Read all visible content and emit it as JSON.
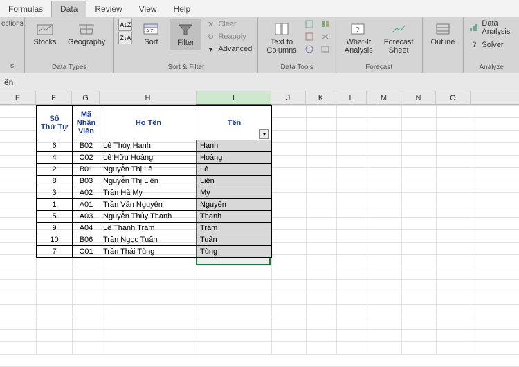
{
  "tabs": {
    "formulas": "Formulas",
    "data": "Data",
    "review": "Review",
    "view": "View",
    "help": "Help"
  },
  "sideLeft": {
    "top": "ections",
    "bottom": "s"
  },
  "ribbon": {
    "dataTypes": {
      "stocks": "Stocks",
      "geography": "Geography",
      "label": "Data Types"
    },
    "sortFilter": {
      "sort": "Sort",
      "filter": "Filter",
      "clear": "Clear",
      "reapply": "Reapply",
      "advanced": "Advanced",
      "label": "Sort & Filter"
    },
    "dataTools": {
      "textToColumns": "Text to\nColumns",
      "label": "Data Tools"
    },
    "forecast": {
      "whatIf": "What-If\nAnalysis",
      "sheet": "Forecast\nSheet",
      "label": "Forecast"
    },
    "outline": {
      "outline": "Outline",
      "label": ""
    },
    "analyze": {
      "dataAnalysis": "Data Analysis",
      "solver": "Solver",
      "label": "Analyze"
    }
  },
  "formulaBar": "ên",
  "columns": [
    "E",
    "F",
    "G",
    "H",
    "I",
    "J",
    "K",
    "L",
    "M",
    "N",
    "O"
  ],
  "headers": {
    "stt": "Số\nThứ Tự",
    "ma": "Mã\nNhân\nViên",
    "hoten": "Họ Tên",
    "ten": "Tên"
  },
  "rows": [
    {
      "stt": "6",
      "ma": "B02",
      "hoten": "Lê Thúy Hạnh",
      "ten": "Hạnh"
    },
    {
      "stt": "4",
      "ma": "C02",
      "hoten": "Lê Hữu Hoàng",
      "ten": "Hoàng"
    },
    {
      "stt": "2",
      "ma": "B01",
      "hoten": "Nguyễn Thị Lê",
      "ten": "Lê"
    },
    {
      "stt": "8",
      "ma": "B03",
      "hoten": "Nguyễn Thị Liên",
      "ten": "Liên"
    },
    {
      "stt": "3",
      "ma": "A02",
      "hoten": "Trần Hà My",
      "ten": "My"
    },
    {
      "stt": "1",
      "ma": "A01",
      "hoten": "Trần Văn Nguyên",
      "ten": "Nguyên"
    },
    {
      "stt": "5",
      "ma": "A03",
      "hoten": "Nguyễn Thủy Thanh",
      "ten": "Thanh"
    },
    {
      "stt": "9",
      "ma": "A04",
      "hoten": "Lê Thanh Trâm",
      "ten": "Trâm"
    },
    {
      "stt": "10",
      "ma": "B06",
      "hoten": "Trần Ngọc Tuấn",
      "ten": "Tuấn"
    },
    {
      "stt": "7",
      "ma": "C01",
      "hoten": "Trần Thái Tùng",
      "ten": "Tùng"
    }
  ]
}
